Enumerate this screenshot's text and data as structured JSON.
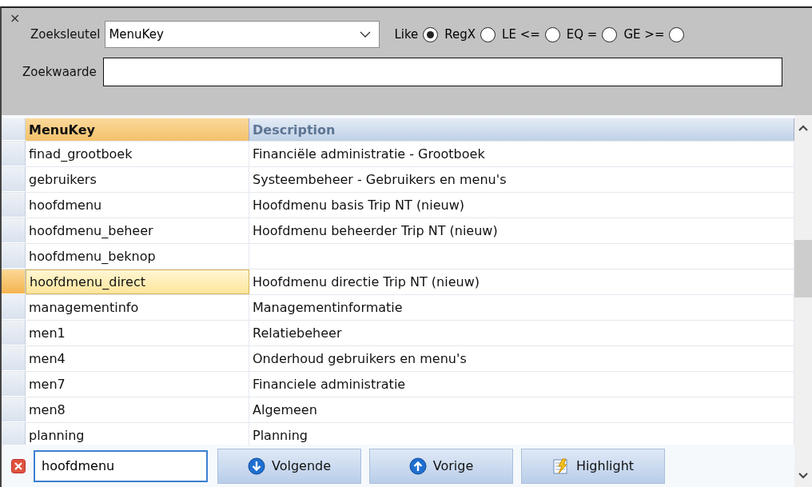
{
  "panel": {
    "close": "×",
    "search_key_label": "Zoeksleutel",
    "search_key_value": "MenuKey",
    "match_modes": [
      {
        "label": "Like",
        "selected": true
      },
      {
        "label": "RegX",
        "selected": false
      },
      {
        "label": "LE <=",
        "selected": false
      },
      {
        "label": "EQ =",
        "selected": false
      },
      {
        "label": "GE >=",
        "selected": false
      }
    ],
    "search_value_label": "Zoekwaarde"
  },
  "table": {
    "columns": [
      {
        "label": "MenuKey",
        "selected": true
      },
      {
        "label": "Description",
        "selected": false
      }
    ],
    "rows": [
      {
        "cells": [
          "finad_grootboek",
          "Financiële administratie - Grootboek"
        ],
        "selected": false
      },
      {
        "cells": [
          "gebruikers",
          "Systeembeheer - Gebruikers en menu's"
        ],
        "selected": false
      },
      {
        "cells": [
          "hoofdmenu",
          "Hoofdmenu basis Trip NT (nieuw)"
        ],
        "selected": false
      },
      {
        "cells": [
          "hoofdmenu_beheer",
          "Hoofdmenu beheerder Trip NT (nieuw)"
        ],
        "selected": false
      },
      {
        "cells": [
          "hoofdmenu_beknop"
        ],
        "selected": false
      },
      {
        "cells": [
          "hoofdmenu_direct",
          "Hoofdmenu directie Trip NT (nieuw)"
        ],
        "selected": true
      },
      {
        "cells": [
          "managementinfo",
          "Managementinformatie"
        ],
        "selected": false
      },
      {
        "cells": [
          "men1",
          "Relatiebeheer"
        ],
        "selected": false
      },
      {
        "cells": [
          "men4",
          "Onderhoud gebruikers en menu's"
        ],
        "selected": false
      },
      {
        "cells": [
          "men7",
          "Financiele administratie"
        ],
        "selected": false
      },
      {
        "cells": [
          "men8",
          "Algemeen"
        ],
        "selected": false
      },
      {
        "cells": [
          "planning",
          "Planning"
        ],
        "selected": false
      }
    ]
  },
  "find_bar": {
    "value": "hoofdmenu",
    "buttons": [
      {
        "label": "Volgende",
        "kind": "down"
      },
      {
        "label": "Vorige",
        "kind": "up"
      },
      {
        "label": "Highlight",
        "kind": "highlight"
      }
    ]
  }
}
